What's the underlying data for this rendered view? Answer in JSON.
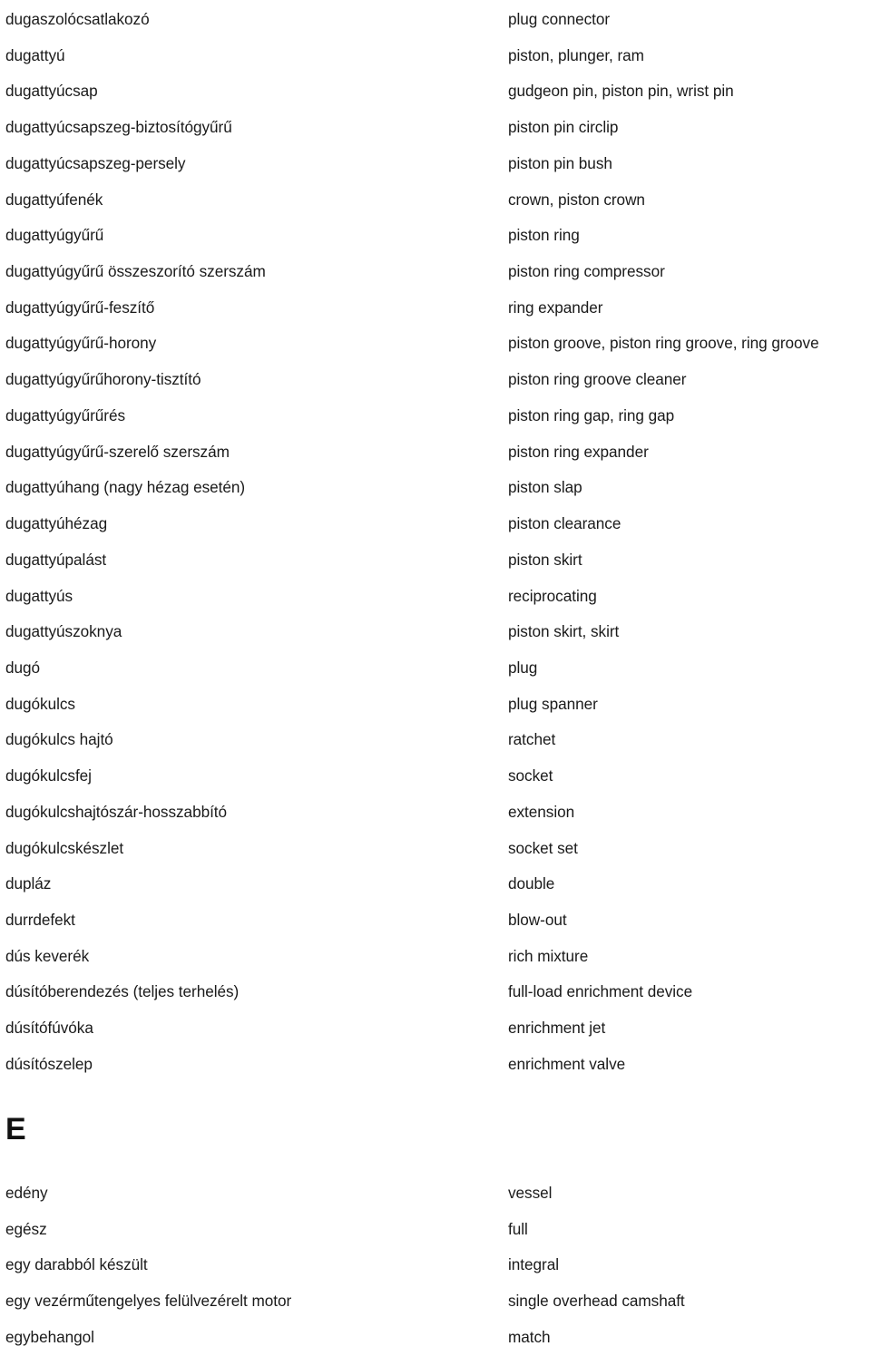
{
  "document": {
    "type": "bilingual-glossary",
    "source_language": "Hungarian",
    "target_language": "English",
    "background_color": "#ffffff",
    "text_color": "#1a1a1a"
  },
  "blocks": [
    {
      "id": "block-d",
      "heading": null,
      "entries": [
        {
          "hu": "dugaszolócsatlakozó",
          "en": "plug connector"
        },
        {
          "hu": "dugattyú",
          "en": "piston, plunger, ram"
        },
        {
          "hu": "dugattyúcsap",
          "en": "gudgeon pin, piston pin, wrist pin"
        },
        {
          "hu": "dugattyúcsapszeg-biztosítógyűrű",
          "en": "piston pin circlip"
        },
        {
          "hu": "dugattyúcsapszeg-persely",
          "en": "piston pin bush"
        },
        {
          "hu": "dugattyúfenék",
          "en": "crown, piston crown"
        },
        {
          "hu": "dugattyúgyűrű",
          "en": "piston ring"
        },
        {
          "hu": "dugattyúgyűrű összeszorító szerszám",
          "en": "piston ring compressor"
        },
        {
          "hu": "dugattyúgyűrű-feszítő",
          "en": "ring expander"
        },
        {
          "hu": "dugattyúgyűrű-horony",
          "en": "piston groove, piston ring groove, ring groove"
        },
        {
          "hu": "dugattyúgyűrűhorony-tisztító",
          "en": "piston ring groove cleaner"
        },
        {
          "hu": "dugattyúgyűrűrés",
          "en": "piston ring gap, ring gap"
        },
        {
          "hu": "dugattyúgyűrű-szerelő szerszám",
          "en": "piston ring expander"
        },
        {
          "hu": "dugattyúhang (nagy hézag esetén)",
          "en": "piston slap"
        },
        {
          "hu": "dugattyúhézag",
          "en": "piston clearance"
        },
        {
          "hu": "dugattyúpalást",
          "en": "piston skirt"
        },
        {
          "hu": "dugattyús",
          "en": "reciprocating"
        },
        {
          "hu": "dugattyúszoknya",
          "en": "piston skirt, skirt"
        },
        {
          "hu": "dugó",
          "en": "plug"
        },
        {
          "hu": "dugókulcs",
          "en": "plug spanner"
        },
        {
          "hu": "dugókulcs hajtó",
          "en": "ratchet"
        },
        {
          "hu": "dugókulcsfej",
          "en": "socket"
        },
        {
          "hu": "dugókulcshajtószár-hosszabbító",
          "en": "extension"
        },
        {
          "hu": "dugókulcskészlet",
          "en": "socket set"
        },
        {
          "hu": "dupláz",
          "en": "double"
        },
        {
          "hu": "durrdefekt",
          "en": "blow-out"
        },
        {
          "hu": "dús keverék",
          "en": "rich mixture"
        },
        {
          "hu": "dúsítóberendezés (teljes terhelés)",
          "en": "full-load enrichment device"
        },
        {
          "hu": "dúsítófúvóka",
          "en": "enrichment jet"
        },
        {
          "hu": "dúsítószelep",
          "en": "enrichment valve"
        }
      ]
    },
    {
      "id": "block-e",
      "heading": "E",
      "entries": [
        {
          "hu": "edény",
          "en": "vessel"
        },
        {
          "hu": "egész",
          "en": "full"
        },
        {
          "hu": "egy darabból készült",
          "en": "integral"
        },
        {
          "hu": "egy vezérműtengelyes felülvezérelt motor",
          "en": "single overhead camshaft"
        },
        {
          "hu": "egybehangol",
          "en": "match"
        }
      ]
    }
  ]
}
